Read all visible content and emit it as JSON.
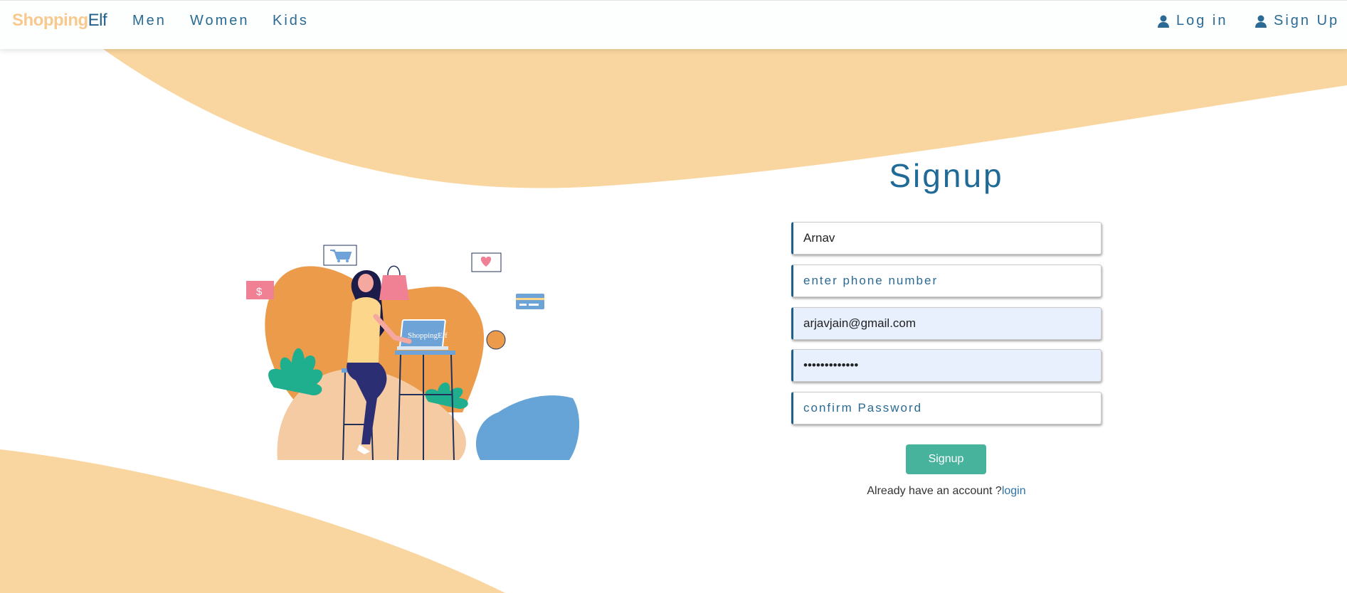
{
  "colors": {
    "peach": "#f9d69f",
    "brand_primary": "#1f5f8b",
    "accent_button": "#47b39d",
    "autofill": "#e8f0fe"
  },
  "navbar": {
    "brand_part1": "Shopping",
    "brand_part2": "Elf",
    "links": [
      "Men",
      "Women",
      "Kids"
    ],
    "login_label": "Log in",
    "signup_label": "Sign Up",
    "login_icon": "user-icon",
    "signup_icon": "user-icon"
  },
  "illustration": {
    "laptop_text": "ShoppingElf",
    "dollar_sign": "$"
  },
  "form": {
    "title": "Signup",
    "name_value": "Arnav",
    "phone_placeholder": "enter phone number",
    "email_value": "arjavjain@gmail.com",
    "password_value": "•••••••••••••",
    "confirm_placeholder": "confirm Password",
    "submit_label": "Signup",
    "already_text": "Already have an account ?",
    "login_link": "login"
  }
}
